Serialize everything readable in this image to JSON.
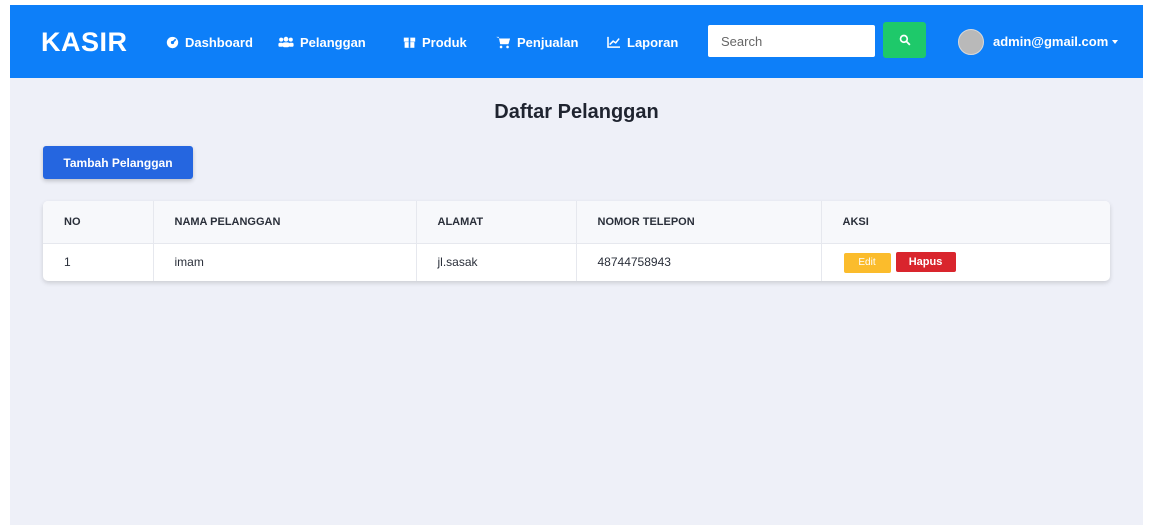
{
  "navbar": {
    "brand": "KASIR",
    "items": [
      {
        "label": "Dashboard",
        "icon": "dashboard-icon"
      },
      {
        "label": "Pelanggan",
        "icon": "users-icon"
      },
      {
        "label": "Produk",
        "icon": "box-icon"
      },
      {
        "label": "Penjualan",
        "icon": "cart-icon"
      },
      {
        "label": "Laporan",
        "icon": "chart-line-icon"
      }
    ],
    "search_placeholder": "Search",
    "user_email": "admin@gmail.com",
    "colors": {
      "bar": "#0d7ff9",
      "search_button": "#1ec96a"
    }
  },
  "page": {
    "title": "Daftar Pelanggan",
    "add_button": "Tambah Pelanggan"
  },
  "table": {
    "headers": [
      "NO",
      "NAMA PELANGGAN",
      "ALAMAT",
      "NOMOR TELEPON",
      "AKSI"
    ],
    "rows": [
      {
        "no": "1",
        "nama": "imam",
        "alamat": "jl.sasak",
        "telepon": "48744758943"
      }
    ],
    "actions": {
      "edit": "Edit",
      "delete": "Hapus"
    }
  }
}
